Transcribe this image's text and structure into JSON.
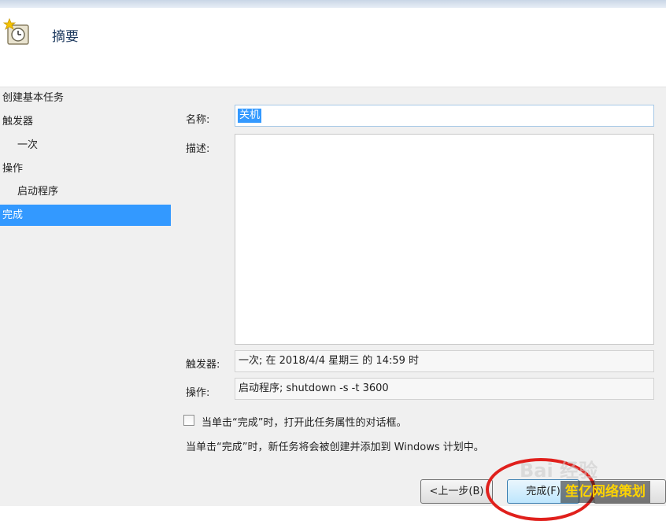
{
  "header": {
    "title": "摘要",
    "icon": "task-clock-icon"
  },
  "nav": {
    "items": [
      {
        "label": "创建基本任务",
        "level": "top",
        "active": false
      },
      {
        "label": "触发器",
        "level": "top",
        "active": false
      },
      {
        "label": "一次",
        "level": "sub",
        "active": false
      },
      {
        "label": "操作",
        "level": "top",
        "active": false
      },
      {
        "label": "启动程序",
        "level": "sub",
        "active": false
      },
      {
        "label": "完成",
        "level": "top",
        "active": true
      }
    ]
  },
  "form": {
    "name_label": "名称:",
    "name_value": "关机",
    "desc_label": "描述:",
    "desc_value": "",
    "trigger_label": "触发器:",
    "trigger_value": "一次; 在 2018/4/4 星期三 的 14:59 时",
    "action_label": "操作:",
    "action_value": "启动程序; shutdown -s -t 3600",
    "checkbox_label": "当单击“完成”时，打开此任务属性的对话框。",
    "info_text": "当单击“完成”时，新任务将会被创建并添加到 Windows 计划中。"
  },
  "buttons": {
    "back": "<上一步(B)",
    "finish": "完成(F)",
    "cancel": ""
  },
  "watermarks": {
    "baidu": "Bai 经验",
    "site": "笙亿网络策划"
  },
  "colors": {
    "accent": "#3399ff",
    "annotation": "#e0201c"
  }
}
